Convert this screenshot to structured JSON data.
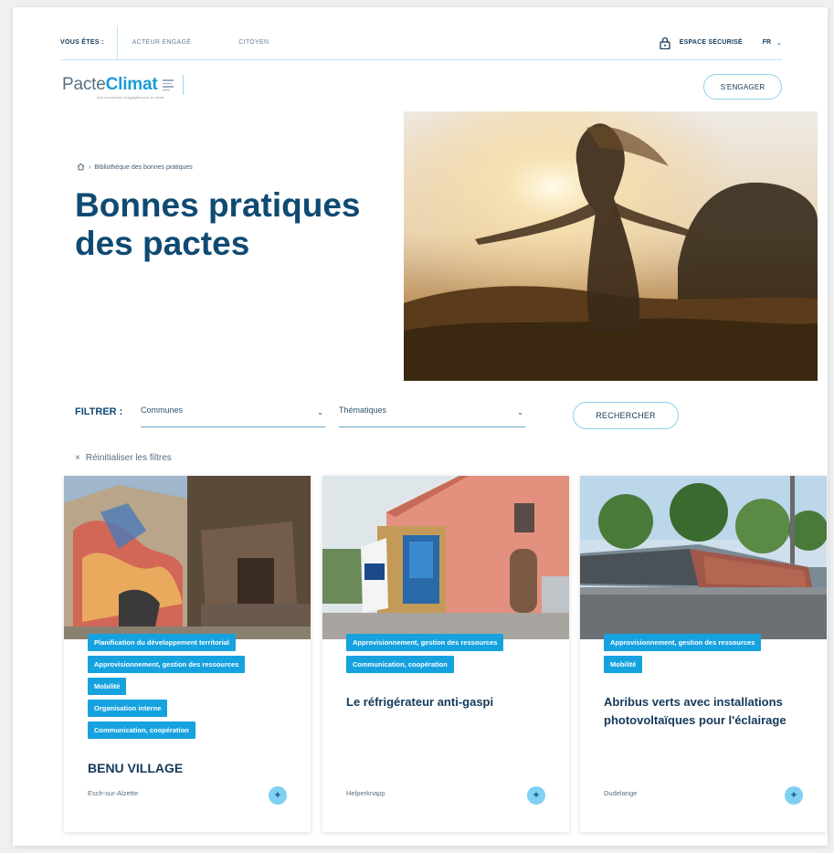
{
  "topbar": {
    "label": "VOUS ÊTES :",
    "links": [
      "ACTEUR ENGAGÉ",
      "CITOYEN"
    ],
    "secure": "ESPACE SÉCURISÉ",
    "lang": "FR"
  },
  "logo": {
    "part1": "Pacte",
    "part2": "Climat",
    "tagline": "Nos communes s'engagent pour le climat"
  },
  "header": {
    "engage_label": "S'ENGAGER"
  },
  "breadcrumb": {
    "current": "Bibliothèque des bonnes pratiques"
  },
  "hero": {
    "title": "Bonnes pratiques des pactes"
  },
  "filters": {
    "label": "FILTRER :",
    "communes": "Communes",
    "thematiques": "Thématiques",
    "search_label": "RECHERCHER",
    "reset_label": "Réinitialiser les filtres"
  },
  "cards": [
    {
      "tags": [
        "Planification du développement territorial",
        "Approvisionnement, gestion des ressources",
        "Mobilité",
        "Organisation interne",
        "Communication, coopération"
      ],
      "title": "BENU VILLAGE",
      "location": "Esch-sur-Alzette"
    },
    {
      "tags": [
        "Approvisionnement, gestion des ressources",
        "Communication, coopération"
      ],
      "title": "Le réfrigérateur anti-gaspi",
      "location": "Helperknapp"
    },
    {
      "tags": [
        "Approvisionnement, gestion des ressources",
        "Mobilité"
      ],
      "title": "Abribus verts avec installations photovoltaïques pour l'éclairage",
      "location": "Dudelange"
    }
  ],
  "colors": {
    "accent": "#16a2df",
    "title": "#0f4a73",
    "text": "#14395a"
  },
  "icons": {
    "lock": "lock-icon",
    "home": "home-icon",
    "close": "close-icon",
    "plus": "plus-icon",
    "chevron": "chevron-down-icon"
  }
}
